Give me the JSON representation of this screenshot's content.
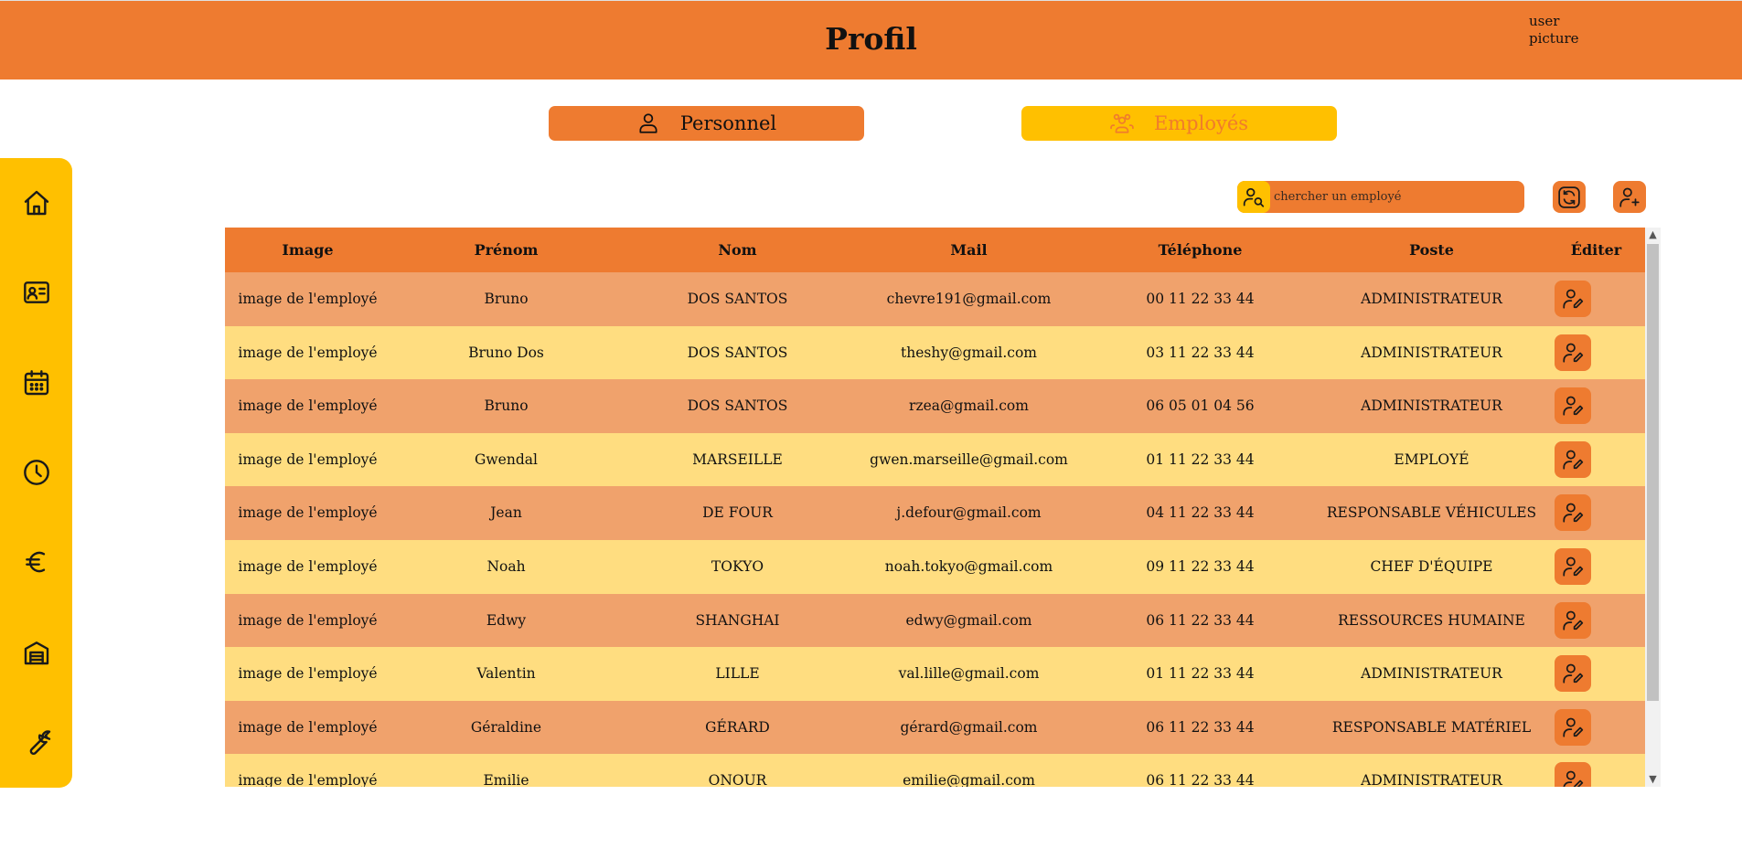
{
  "header": {
    "title": "Profil",
    "user_picture": "user picture"
  },
  "tabs": [
    {
      "label": "Personnel",
      "icon": "user-icon",
      "color": "#ee7b30"
    },
    {
      "label": "Employés",
      "icon": "users-icon",
      "color": "#ffc000"
    }
  ],
  "sidebar": {
    "items": [
      {
        "icon": "home-icon"
      },
      {
        "icon": "id-card-icon"
      },
      {
        "icon": "calendar-icon"
      },
      {
        "icon": "clock-icon"
      },
      {
        "icon": "euro-icon"
      },
      {
        "icon": "warehouse-icon"
      },
      {
        "icon": "wrench-icon"
      }
    ]
  },
  "search": {
    "placeholder": "chercher un employé"
  },
  "table": {
    "columns": [
      "Image",
      "Prénom",
      "Nom",
      "Mail",
      "Téléphone",
      "Poste",
      "Éditer"
    ],
    "rows": [
      {
        "image": "image de l'employé",
        "prenom": "Bruno",
        "nom": "DOS SANTOS",
        "mail": "chevre191@gmail.com",
        "telephone": "00 11 22 33 44",
        "poste": "ADMINISTRATEUR"
      },
      {
        "image": "image de l'employé",
        "prenom": "Bruno Dos",
        "nom": "DOS SANTOS",
        "mail": "theshy@gmail.com",
        "telephone": "03 11 22 33 44",
        "poste": "ADMINISTRATEUR"
      },
      {
        "image": "image de l'employé",
        "prenom": "Bruno",
        "nom": "DOS SANTOS",
        "mail": "rzea@gmail.com",
        "telephone": "06 05 01 04 56",
        "poste": "ADMINISTRATEUR"
      },
      {
        "image": "image de l'employé",
        "prenom": "Gwendal",
        "nom": "MARSEILLE",
        "mail": "gwen.marseille@gmail.com",
        "telephone": "01 11 22 33 44",
        "poste": "EMPLOYÉ"
      },
      {
        "image": "image de l'employé",
        "prenom": "Jean",
        "nom": "DE FOUR",
        "mail": "j.defour@gmail.com",
        "telephone": "04 11 22 33 44",
        "poste": "RESPONSABLE VÉHICULES"
      },
      {
        "image": "image de l'employé",
        "prenom": "Noah",
        "nom": "TOKYO",
        "mail": "noah.tokyo@gmail.com",
        "telephone": "09 11 22 33 44",
        "poste": "CHEF D'ÉQUIPE"
      },
      {
        "image": "image de l'employé",
        "prenom": "Edwy",
        "nom": "SHANGHAI",
        "mail": "edwy@gmail.com",
        "telephone": "06 11 22 33 44",
        "poste": "RESSOURCES HUMAINE"
      },
      {
        "image": "image de l'employé",
        "prenom": "Valentin",
        "nom": "LILLE",
        "mail": "val.lille@gmail.com",
        "telephone": "01 11 22 33 44",
        "poste": "ADMINISTRATEUR"
      },
      {
        "image": "image de l'employé",
        "prenom": "Géraldine",
        "nom": "GÉRARD",
        "mail": "gérard@gmail.com",
        "telephone": "06 11 22 33 44",
        "poste": "RESPONSABLE MATÉRIEL"
      },
      {
        "image": "image de l'employé",
        "prenom": "Emilie",
        "nom": "ONOUR",
        "mail": "emilie@gmail.com",
        "telephone": "06 11 22 33 44",
        "poste": "ADMINISTRATEUR"
      }
    ]
  },
  "colors": {
    "orange": "#ee7b30",
    "yellow": "#ffc000",
    "row_odd": "#f0a26c",
    "row_even": "#ffdd80"
  }
}
